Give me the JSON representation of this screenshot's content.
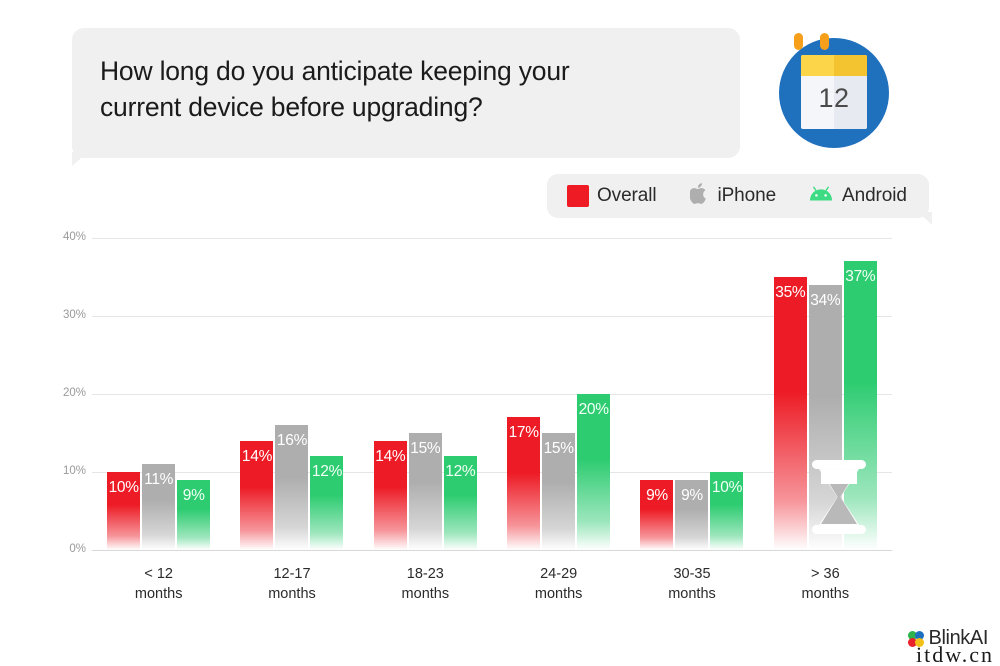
{
  "question": {
    "line1": "How long do you anticipate keeping your",
    "line2": "current device before upgrading?"
  },
  "calendar_icon": {
    "name": "calendar-icon",
    "day": "12",
    "circle_color": "#1f70bd",
    "header_color": "#fcd548"
  },
  "legend": {
    "items": [
      {
        "label": "Overall",
        "icon": "red-square-icon",
        "color": "#ef1b24"
      },
      {
        "label": "iPhone",
        "icon": "apple-logo-icon",
        "color": "#aeaeae"
      },
      {
        "label": "Android",
        "icon": "android-robot-icon",
        "color": "#2ecc71"
      }
    ]
  },
  "overlay_icon": {
    "name": "hourglass-icon"
  },
  "watermarks": {
    "brand": "BlinkAI",
    "site": "itdw.cn"
  },
  "chart_data": {
    "type": "bar",
    "title": "How long do you anticipate keeping your current device before upgrading?",
    "xlabel": "",
    "ylabel": "",
    "ylim": [
      0,
      40
    ],
    "ytick_labels": [
      "0%",
      "10%",
      "20%",
      "30%",
      "40%"
    ],
    "ytick_values": [
      0,
      10,
      20,
      30,
      40
    ],
    "grid": true,
    "legend_position": "top-right",
    "categories": [
      "< 12\nmonths",
      "12-17\nmonths",
      "18-23\nmonths",
      "24-29\nmonths",
      "30-35\nmonths",
      "> 36\nmonths"
    ],
    "category_lines": [
      [
        "< 12",
        "months"
      ],
      [
        "12-17",
        "months"
      ],
      [
        "18-23",
        "months"
      ],
      [
        "24-29",
        "months"
      ],
      [
        "30-35",
        "months"
      ],
      [
        "> 36",
        "months"
      ]
    ],
    "series": [
      {
        "name": "Overall",
        "color": "#ed1b25",
        "values": [
          10,
          14,
          14,
          17,
          9,
          35
        ],
        "labels": [
          "10%",
          "14%",
          "14%",
          "17%",
          "9%",
          "35%"
        ]
      },
      {
        "name": "iPhone",
        "color": "#aeaeae",
        "values": [
          11,
          16,
          15,
          15,
          9,
          34
        ],
        "labels": [
          "11%",
          "16%",
          "15%",
          "15%",
          "9%",
          "34%"
        ]
      },
      {
        "name": "Android",
        "color": "#2ecc71",
        "values": [
          9,
          12,
          12,
          20,
          10,
          37
        ],
        "labels": [
          "9%",
          "12%",
          "12%",
          "20%",
          "10%",
          "37%"
        ]
      }
    ]
  }
}
